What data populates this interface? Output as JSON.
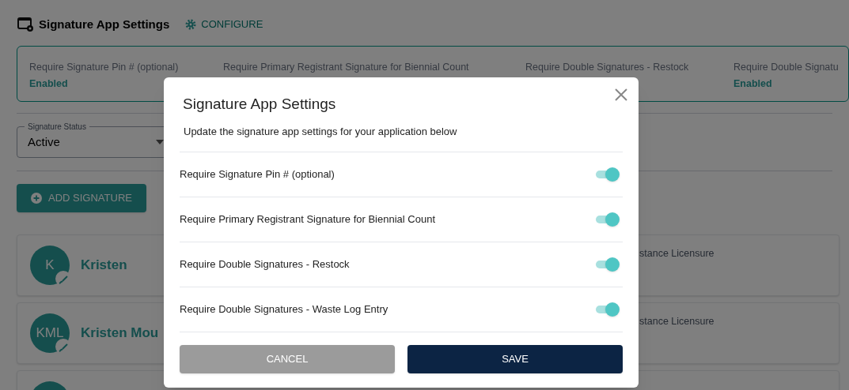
{
  "page": {
    "title": "Signature App Settings",
    "configure": "CONFIGURE"
  },
  "settings_summary": [
    {
      "label": "Require Signature Pin # (optional)",
      "value": "Enabled"
    },
    {
      "label": "Require Primary Registrant Signature for Biennial Count"
    },
    {
      "label": "Require Double Signatures - Restock"
    },
    {
      "label": "Require Double Signatu",
      "value": "Enabled"
    }
  ],
  "status_select": {
    "label": "Signature Status",
    "value": "Active"
  },
  "add_button": "ADD SIGNATURE",
  "signatures": [
    {
      "kind": "full",
      "initials": "K",
      "name": "Kristen",
      "detail": "stance Licensure"
    },
    {
      "kind": "full",
      "initials": "KML",
      "name": "Kristen Mou",
      "detail": "stance Licensure"
    },
    {
      "kind": "cut"
    }
  ],
  "dialog": {
    "title": "Signature App Settings",
    "subtitle": "Update the signature app settings for your application below",
    "settings": [
      {
        "label": "Require Signature Pin # (optional)",
        "on": true
      },
      {
        "label": "Require Primary Registrant Signature for Biennial Count",
        "on": true
      },
      {
        "label": "Require Double Signatures - Restock",
        "on": true
      },
      {
        "label": "Require Double Signatures - Waste Log Entry",
        "on": true
      }
    ],
    "cancel": "CANCEL",
    "save": "SAVE"
  }
}
